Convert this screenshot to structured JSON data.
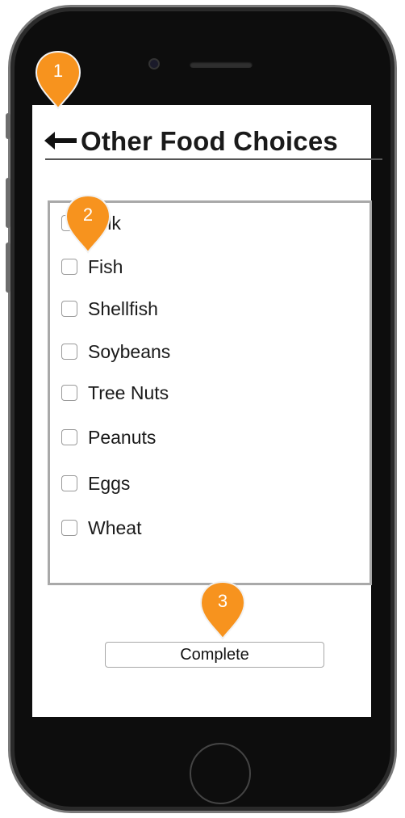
{
  "screen": {
    "title": "Other Food Choices",
    "items": [
      {
        "label": "Milk",
        "checked": false
      },
      {
        "label": "Fish",
        "checked": false
      },
      {
        "label": "Shellfish",
        "checked": false
      },
      {
        "label": "Soybeans",
        "checked": false
      },
      {
        "label": "Tree Nuts",
        "checked": false
      },
      {
        "label": "Peanuts",
        "checked": false
      },
      {
        "label": "Eggs",
        "checked": false
      },
      {
        "label": "Wheat",
        "checked": false
      }
    ],
    "complete_label": "Complete"
  },
  "markers": [
    "1",
    "2",
    "3"
  ],
  "colors": {
    "marker": "#f7931e",
    "frame": "#0d0d0d",
    "text": "#1a1a1a"
  }
}
